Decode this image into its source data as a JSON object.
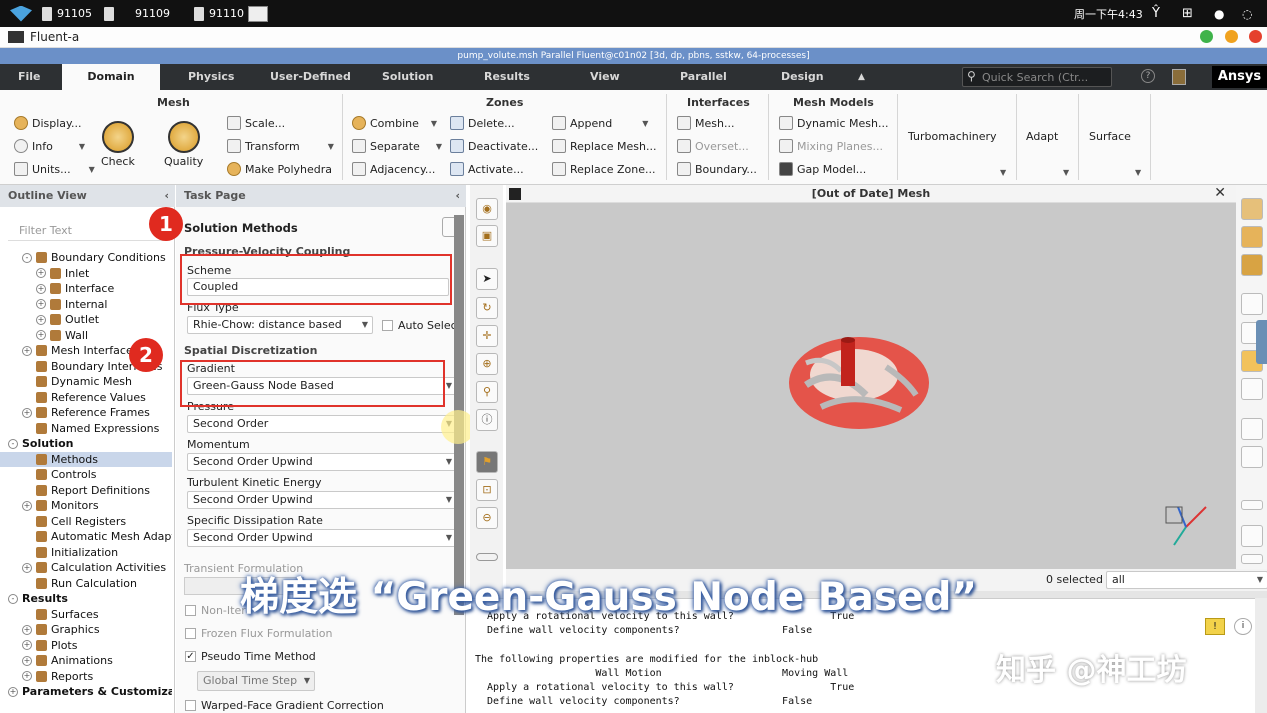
{
  "taskbar": {
    "items": [
      {
        "label": "91105"
      },
      {
        "label": "91109"
      },
      {
        "label": "91110"
      }
    ],
    "clock": "周一下午4:43"
  },
  "window": {
    "title": "Fluent-a"
  },
  "fluent_title": "pump_volute.msh Parallel Fluent@c01n02  [3d, dp, pbns, sstkw, 64-processes]",
  "menu": {
    "items": [
      "File",
      "Domain",
      "Physics",
      "User-Defined",
      "Solution",
      "Results",
      "View",
      "Parallel",
      "Design"
    ],
    "active": "Domain",
    "search_placeholder": "Quick Search (Ctr...",
    "brand": "Ansys"
  },
  "ribbon": {
    "mesh": {
      "title": "Mesh",
      "display": "Display...",
      "info": "Info",
      "units": "Units...",
      "check": "Check",
      "quality": "Quality",
      "scale": "Scale...",
      "transform": "Transform",
      "polyhedra": "Make Polyhedra"
    },
    "zones": {
      "title": "Zones",
      "combine": "Combine",
      "separate": "Separate",
      "adjacency": "Adjacency...",
      "delete": "Delete...",
      "deactivate": "Deactivate...",
      "activate": "Activate...",
      "append": "Append",
      "replace_mesh": "Replace Mesh...",
      "replace_zone": "Replace Zone..."
    },
    "interfaces": {
      "title": "Interfaces",
      "mesh": "Mesh...",
      "overset": "Overset...",
      "boundary": "Boundary..."
    },
    "mesh_models": {
      "title": "Mesh Models",
      "dynamic": "Dynamic Mesh...",
      "mixing": "Mixing Planes...",
      "gap": "Gap Model..."
    },
    "turbo": "Turbomachinery",
    "adapt": "Adapt",
    "surface": "Surface"
  },
  "outline": {
    "title": "Outline View",
    "filter_placeholder": "Filter Text",
    "items": [
      {
        "label": "Boundary Conditions",
        "indent": 1,
        "pm": "-"
      },
      {
        "label": "Inlet",
        "indent": 2,
        "pm": "+"
      },
      {
        "label": "Interface",
        "indent": 2,
        "pm": "+"
      },
      {
        "label": "Internal",
        "indent": 2,
        "pm": "+"
      },
      {
        "label": "Outlet",
        "indent": 2,
        "pm": "+"
      },
      {
        "label": "Wall",
        "indent": 2,
        "pm": "+"
      },
      {
        "label": "Mesh Interfaces",
        "indent": 1,
        "pm": "+"
      },
      {
        "label": "Boundary Interfaces",
        "indent": 1,
        "pm": ""
      },
      {
        "label": "Dynamic Mesh",
        "indent": 1,
        "pm": ""
      },
      {
        "label": "Reference Values",
        "indent": 1,
        "pm": ""
      },
      {
        "label": "Reference Frames",
        "indent": 1,
        "pm": "+"
      },
      {
        "label": "Named Expressions",
        "indent": 1,
        "pm": ""
      },
      {
        "label": "Solution",
        "indent": 0,
        "pm": "-",
        "bold": true
      },
      {
        "label": "Methods",
        "indent": 1,
        "pm": "",
        "selected": true
      },
      {
        "label": "Controls",
        "indent": 1,
        "pm": ""
      },
      {
        "label": "Report Definitions",
        "indent": 1,
        "pm": ""
      },
      {
        "label": "Monitors",
        "indent": 1,
        "pm": "+"
      },
      {
        "label": "Cell Registers",
        "indent": 1,
        "pm": ""
      },
      {
        "label": "Automatic Mesh Adaption",
        "indent": 1,
        "pm": ""
      },
      {
        "label": "Initialization",
        "indent": 1,
        "pm": ""
      },
      {
        "label": "Calculation Activities",
        "indent": 1,
        "pm": "+"
      },
      {
        "label": "Run Calculation",
        "indent": 1,
        "pm": ""
      },
      {
        "label": "Results",
        "indent": 0,
        "pm": "-",
        "bold": true
      },
      {
        "label": "Surfaces",
        "indent": 1,
        "pm": ""
      },
      {
        "label": "Graphics",
        "indent": 1,
        "pm": "+"
      },
      {
        "label": "Plots",
        "indent": 1,
        "pm": "+"
      },
      {
        "label": "Animations",
        "indent": 1,
        "pm": "+"
      },
      {
        "label": "Reports",
        "indent": 1,
        "pm": "+"
      },
      {
        "label": "Parameters & Customization",
        "indent": 0,
        "pm": "+",
        "bold": true
      }
    ]
  },
  "task": {
    "title": "Task Page",
    "heading": "Solution Methods",
    "pv_coupling": "Pressure-Velocity Coupling",
    "scheme_label": "Scheme",
    "scheme_value": "Coupled",
    "flux_label": "Flux Type",
    "flux_value": "Rhie-Chow: distance based",
    "auto_select": "Auto Select",
    "spatial": "Spatial Discretization",
    "gradient_label": "Gradient",
    "gradient_value": "Green-Gauss Node Based",
    "pressure_label": "Pressure",
    "pressure_value": "Second Order",
    "momentum_label": "Momentum",
    "momentum_value": "Second Order Upwind",
    "tke_label": "Turbulent Kinetic Energy",
    "tke_value": "Second Order Upwind",
    "sdr_label": "Specific Dissipation Rate",
    "sdr_value": "Second Order Upwind",
    "transient": "Transient Formulation",
    "non_iter": "Non-Iterative Time Advancement",
    "frozen": "Frozen Flux Formulation",
    "pseudo": "Pseudo Time Method",
    "global_step": "Global Time Step",
    "warped": "Warped-Face Gradient Correction"
  },
  "annotations": {
    "badge1": "1",
    "badge2": "2"
  },
  "viewport": {
    "title": "[Out of Date] Mesh"
  },
  "selection": {
    "count": "0 selected",
    "filter": "all"
  },
  "console_lines": [
    "  Apply a rotational velocity to this wall?                True",
    "  Define wall velocity components?                 False",
    "",
    "The following properties are modified for the inblock-hub",
    "                    Wall Motion                    Moving Wall",
    "  Apply a rotational velocity to this wall?                True",
    "  Define wall velocity components?                 False"
  ],
  "caption": "梯度选 “Green-Gauss Node Based”",
  "watermark": "知乎 @神工坊",
  "colors": {
    "accent_red": "#e0332b",
    "menu_bg": "#2d3033",
    "title_blue": "#6b90c8",
    "impeller": "#e4544a"
  }
}
